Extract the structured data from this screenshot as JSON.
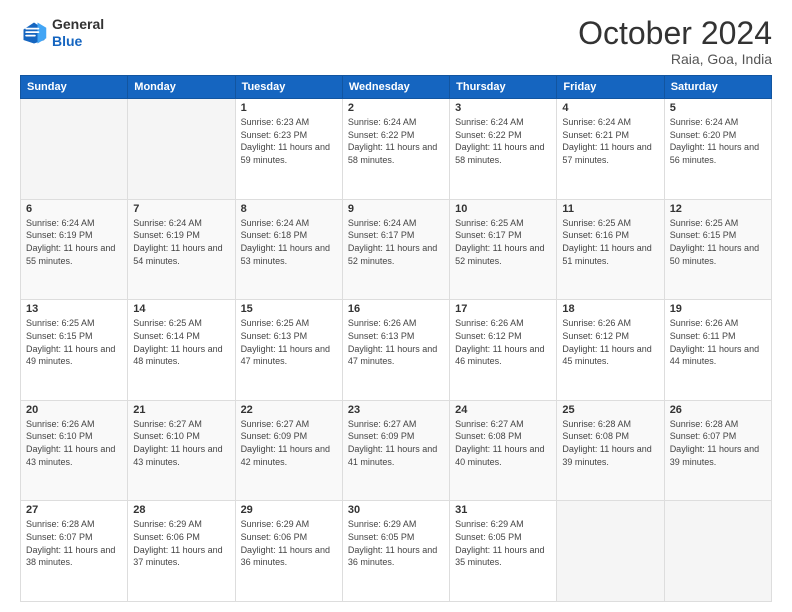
{
  "logo": {
    "text_general": "General",
    "text_blue": "Blue"
  },
  "header": {
    "month": "October 2024",
    "location": "Raia, Goa, India"
  },
  "days_of_week": [
    "Sunday",
    "Monday",
    "Tuesday",
    "Wednesday",
    "Thursday",
    "Friday",
    "Saturday"
  ],
  "weeks": [
    [
      {
        "day": "",
        "empty": true
      },
      {
        "day": "",
        "empty": true
      },
      {
        "day": "1",
        "sunrise": "Sunrise: 6:23 AM",
        "sunset": "Sunset: 6:23 PM",
        "daylight": "Daylight: 11 hours and 59 minutes."
      },
      {
        "day": "2",
        "sunrise": "Sunrise: 6:24 AM",
        "sunset": "Sunset: 6:22 PM",
        "daylight": "Daylight: 11 hours and 58 minutes."
      },
      {
        "day": "3",
        "sunrise": "Sunrise: 6:24 AM",
        "sunset": "Sunset: 6:22 PM",
        "daylight": "Daylight: 11 hours and 58 minutes."
      },
      {
        "day": "4",
        "sunrise": "Sunrise: 6:24 AM",
        "sunset": "Sunset: 6:21 PM",
        "daylight": "Daylight: 11 hours and 57 minutes."
      },
      {
        "day": "5",
        "sunrise": "Sunrise: 6:24 AM",
        "sunset": "Sunset: 6:20 PM",
        "daylight": "Daylight: 11 hours and 56 minutes."
      }
    ],
    [
      {
        "day": "6",
        "sunrise": "Sunrise: 6:24 AM",
        "sunset": "Sunset: 6:19 PM",
        "daylight": "Daylight: 11 hours and 55 minutes."
      },
      {
        "day": "7",
        "sunrise": "Sunrise: 6:24 AM",
        "sunset": "Sunset: 6:19 PM",
        "daylight": "Daylight: 11 hours and 54 minutes."
      },
      {
        "day": "8",
        "sunrise": "Sunrise: 6:24 AM",
        "sunset": "Sunset: 6:18 PM",
        "daylight": "Daylight: 11 hours and 53 minutes."
      },
      {
        "day": "9",
        "sunrise": "Sunrise: 6:24 AM",
        "sunset": "Sunset: 6:17 PM",
        "daylight": "Daylight: 11 hours and 52 minutes."
      },
      {
        "day": "10",
        "sunrise": "Sunrise: 6:25 AM",
        "sunset": "Sunset: 6:17 PM",
        "daylight": "Daylight: 11 hours and 52 minutes."
      },
      {
        "day": "11",
        "sunrise": "Sunrise: 6:25 AM",
        "sunset": "Sunset: 6:16 PM",
        "daylight": "Daylight: 11 hours and 51 minutes."
      },
      {
        "day": "12",
        "sunrise": "Sunrise: 6:25 AM",
        "sunset": "Sunset: 6:15 PM",
        "daylight": "Daylight: 11 hours and 50 minutes."
      }
    ],
    [
      {
        "day": "13",
        "sunrise": "Sunrise: 6:25 AM",
        "sunset": "Sunset: 6:15 PM",
        "daylight": "Daylight: 11 hours and 49 minutes."
      },
      {
        "day": "14",
        "sunrise": "Sunrise: 6:25 AM",
        "sunset": "Sunset: 6:14 PM",
        "daylight": "Daylight: 11 hours and 48 minutes."
      },
      {
        "day": "15",
        "sunrise": "Sunrise: 6:25 AM",
        "sunset": "Sunset: 6:13 PM",
        "daylight": "Daylight: 11 hours and 47 minutes."
      },
      {
        "day": "16",
        "sunrise": "Sunrise: 6:26 AM",
        "sunset": "Sunset: 6:13 PM",
        "daylight": "Daylight: 11 hours and 47 minutes."
      },
      {
        "day": "17",
        "sunrise": "Sunrise: 6:26 AM",
        "sunset": "Sunset: 6:12 PM",
        "daylight": "Daylight: 11 hours and 46 minutes."
      },
      {
        "day": "18",
        "sunrise": "Sunrise: 6:26 AM",
        "sunset": "Sunset: 6:12 PM",
        "daylight": "Daylight: 11 hours and 45 minutes."
      },
      {
        "day": "19",
        "sunrise": "Sunrise: 6:26 AM",
        "sunset": "Sunset: 6:11 PM",
        "daylight": "Daylight: 11 hours and 44 minutes."
      }
    ],
    [
      {
        "day": "20",
        "sunrise": "Sunrise: 6:26 AM",
        "sunset": "Sunset: 6:10 PM",
        "daylight": "Daylight: 11 hours and 43 minutes."
      },
      {
        "day": "21",
        "sunrise": "Sunrise: 6:27 AM",
        "sunset": "Sunset: 6:10 PM",
        "daylight": "Daylight: 11 hours and 43 minutes."
      },
      {
        "day": "22",
        "sunrise": "Sunrise: 6:27 AM",
        "sunset": "Sunset: 6:09 PM",
        "daylight": "Daylight: 11 hours and 42 minutes."
      },
      {
        "day": "23",
        "sunrise": "Sunrise: 6:27 AM",
        "sunset": "Sunset: 6:09 PM",
        "daylight": "Daylight: 11 hours and 41 minutes."
      },
      {
        "day": "24",
        "sunrise": "Sunrise: 6:27 AM",
        "sunset": "Sunset: 6:08 PM",
        "daylight": "Daylight: 11 hours and 40 minutes."
      },
      {
        "day": "25",
        "sunrise": "Sunrise: 6:28 AM",
        "sunset": "Sunset: 6:08 PM",
        "daylight": "Daylight: 11 hours and 39 minutes."
      },
      {
        "day": "26",
        "sunrise": "Sunrise: 6:28 AM",
        "sunset": "Sunset: 6:07 PM",
        "daylight": "Daylight: 11 hours and 39 minutes."
      }
    ],
    [
      {
        "day": "27",
        "sunrise": "Sunrise: 6:28 AM",
        "sunset": "Sunset: 6:07 PM",
        "daylight": "Daylight: 11 hours and 38 minutes."
      },
      {
        "day": "28",
        "sunrise": "Sunrise: 6:29 AM",
        "sunset": "Sunset: 6:06 PM",
        "daylight": "Daylight: 11 hours and 37 minutes."
      },
      {
        "day": "29",
        "sunrise": "Sunrise: 6:29 AM",
        "sunset": "Sunset: 6:06 PM",
        "daylight": "Daylight: 11 hours and 36 minutes."
      },
      {
        "day": "30",
        "sunrise": "Sunrise: 6:29 AM",
        "sunset": "Sunset: 6:05 PM",
        "daylight": "Daylight: 11 hours and 36 minutes."
      },
      {
        "day": "31",
        "sunrise": "Sunrise: 6:29 AM",
        "sunset": "Sunset: 6:05 PM",
        "daylight": "Daylight: 11 hours and 35 minutes."
      },
      {
        "day": "",
        "empty": true
      },
      {
        "day": "",
        "empty": true
      }
    ]
  ]
}
